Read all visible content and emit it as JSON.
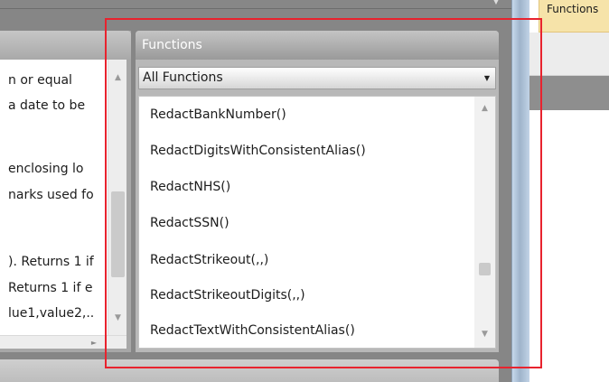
{
  "left_panel": {
    "descriptions": [
      "n or equal",
      " a date to be",
      "",
      "enclosing lo",
      "narks used fo",
      "",
      "). Returns 1 if",
      "Returns 1 if e",
      "lue1,value2,.."
    ]
  },
  "functions_panel": {
    "title": "Functions",
    "category_selected": "All Functions",
    "items": [
      "RedactBankNumber()",
      "RedactDigitsWithConsistentAlias()",
      "RedactNHS()",
      "RedactSSN()",
      "RedactStrikeout(,,)",
      "RedactStrikeoutDigits(,,)",
      "RedactTextWithConsistentAlias()"
    ]
  },
  "right_side": {
    "tab_label": "Functions"
  },
  "icons": {
    "scroll_up": "▲",
    "scroll_down": "▼",
    "scroll_right": "►",
    "dropdown": "▼",
    "top_arrow": "▼"
  },
  "colors": {
    "highlight": "#e8232e",
    "panel_header": "#a9a9a9",
    "right_tab": "#f6e3a9"
  }
}
